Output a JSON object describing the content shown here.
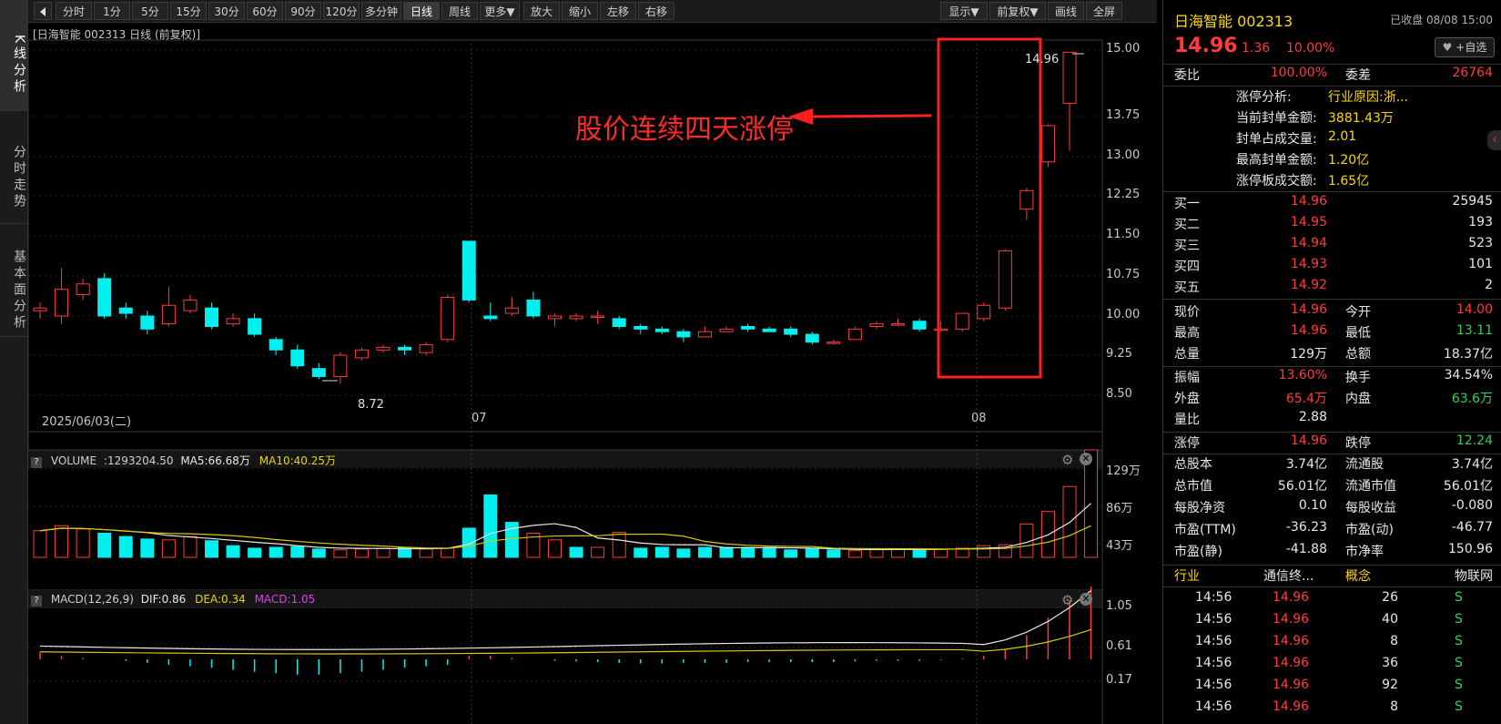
{
  "left_tabs": [
    "K线分析",
    "分时走势",
    "基本面分析"
  ],
  "toolbar": {
    "back_icon": "panel-toggle-icon",
    "periods": [
      "分时",
      "1分",
      "5分",
      "15分",
      "30分",
      "60分",
      "90分",
      "120分",
      "多分钟",
      "日线",
      "周线",
      "更多▼"
    ],
    "active_period": "日线",
    "actions": [
      "放大",
      "缩小",
      "左移",
      "右移"
    ],
    "right_actions": [
      "显示▼",
      "前复权▼",
      "画线",
      "全屏"
    ]
  },
  "chart_title": "日海智能 002313 日线 (前复权)",
  "annotation": "股价连续四天涨停",
  "high_label": "14.96",
  "low_label": "8.72",
  "y_ticks": [
    "15.00",
    "13.75",
    "13.00",
    "12.25",
    "11.50",
    "10.75",
    "10.00",
    "9.25",
    "8.50"
  ],
  "x_dates": [
    "2025/06/03(二)",
    "07",
    "08"
  ],
  "volume_header": {
    "name": "VOLUME",
    "vol": ":1293204.50",
    "ma5": "MA5:66.68万",
    "ma10": "MA10:40.25万"
  },
  "volume_ticks": [
    "129万",
    "86万",
    "43万"
  ],
  "macd_header": {
    "name": "MACD(12,26,9)",
    "dif": "DIF:0.86",
    "dea": "DEA:0.34",
    "macd": "MACD:1.05"
  },
  "macd_ticks": [
    "1.05",
    "0.61",
    "0.17"
  ],
  "chart_data": {
    "type": "candlestick",
    "candles": [
      [
        10.1,
        10.15,
        10.25,
        9.95
      ],
      [
        10.0,
        10.5,
        10.9,
        9.85
      ],
      [
        10.4,
        10.6,
        10.7,
        10.3
      ],
      [
        10.7,
        10.0,
        10.8,
        9.95
      ],
      [
        10.15,
        10.05,
        10.25,
        9.95
      ],
      [
        10.0,
        9.75,
        10.1,
        9.65
      ],
      [
        9.85,
        10.2,
        10.55,
        9.8
      ],
      [
        10.1,
        10.3,
        10.4,
        10.05
      ],
      [
        10.15,
        9.8,
        10.25,
        9.75
      ],
      [
        9.85,
        9.95,
        10.05,
        9.8
      ],
      [
        9.95,
        9.65,
        10.05,
        9.6
      ],
      [
        9.55,
        9.35,
        9.6,
        9.25
      ],
      [
        9.35,
        9.05,
        9.45,
        9.0
      ],
      [
        9.0,
        8.85,
        9.1,
        8.8
      ],
      [
        8.85,
        9.25,
        9.3,
        8.72
      ],
      [
        9.2,
        9.35,
        9.4,
        9.15
      ],
      [
        9.35,
        9.4,
        9.45,
        9.3
      ],
      [
        9.4,
        9.35,
        9.45,
        9.25
      ],
      [
        9.3,
        9.45,
        9.5,
        9.25
      ],
      [
        9.55,
        10.35,
        10.4,
        9.5
      ],
      [
        11.4,
        10.3,
        11.4,
        10.25
      ],
      [
        10.0,
        9.95,
        10.25,
        9.9
      ],
      [
        10.05,
        10.15,
        10.35,
        10.0
      ],
      [
        10.3,
        10.0,
        10.45,
        9.95
      ],
      [
        9.95,
        10.0,
        10.05,
        9.8
      ],
      [
        9.95,
        10.0,
        10.05,
        9.9
      ],
      [
        10.0,
        10.0,
        10.1,
        9.85
      ],
      [
        9.95,
        9.8,
        10.0,
        9.75
      ],
      [
        9.8,
        9.75,
        9.85,
        9.65
      ],
      [
        9.75,
        9.7,
        9.8,
        9.65
      ],
      [
        9.7,
        9.6,
        9.75,
        9.5
      ],
      [
        9.6,
        9.7,
        9.8,
        9.6
      ],
      [
        9.7,
        9.75,
        9.8,
        9.7
      ],
      [
        9.8,
        9.75,
        9.85,
        9.7
      ],
      [
        9.75,
        9.7,
        9.8,
        9.7
      ],
      [
        9.75,
        9.65,
        9.8,
        9.6
      ],
      [
        9.65,
        9.5,
        9.7,
        9.45
      ],
      [
        9.5,
        9.5,
        9.55,
        9.45
      ],
      [
        9.55,
        9.75,
        9.8,
        9.55
      ],
      [
        9.8,
        9.85,
        9.9,
        9.75
      ],
      [
        9.85,
        9.85,
        9.95,
        9.8
      ],
      [
        9.9,
        9.75,
        9.95,
        9.7
      ],
      [
        9.75,
        9.75,
        9.9,
        9.7
      ],
      [
        9.75,
        10.05,
        10.05,
        9.7
      ],
      [
        9.95,
        10.2,
        10.25,
        9.9
      ],
      [
        10.15,
        11.22,
        11.25,
        10.1
      ],
      [
        12.0,
        12.35,
        12.4,
        11.8
      ],
      [
        12.9,
        13.58,
        13.6,
        12.8
      ],
      [
        14.0,
        14.96,
        14.96,
        13.11
      ]
    ],
    "volume_wan": [
      32,
      38,
      34,
      29,
      25,
      22,
      21,
      25,
      20,
      14,
      11,
      12,
      13,
      10,
      9,
      10,
      11,
      12,
      10,
      11,
      35,
      75,
      42,
      29,
      21,
      12,
      12,
      30,
      11,
      12,
      10,
      12,
      12,
      12,
      12,
      9,
      10,
      9,
      8,
      10,
      10,
      10,
      10,
      11,
      14,
      15,
      40,
      55,
      85,
      129
    ],
    "volume_up": [
      true,
      true,
      true,
      false,
      false,
      false,
      true,
      true,
      false,
      false,
      false,
      false,
      false,
      false,
      true,
      true,
      true,
      false,
      true,
      true,
      false,
      false,
      false,
      true,
      true,
      false,
      true,
      true,
      false,
      false,
      false,
      false,
      false,
      false,
      false,
      false,
      false,
      false,
      true,
      true,
      true,
      false,
      true,
      true,
      true,
      true,
      true,
      true,
      true,
      true
    ],
    "macd_hist": [
      0.1,
      0.05,
      0.02,
      0.0,
      -0.02,
      -0.05,
      -0.08,
      -0.1,
      -0.12,
      -0.15,
      -0.18,
      -0.2,
      -0.22,
      -0.22,
      -0.2,
      -0.18,
      -0.15,
      -0.12,
      -0.1,
      -0.08,
      0.05,
      0.05,
      0.02,
      0.0,
      -0.02,
      -0.03,
      -0.04,
      -0.05,
      -0.06,
      -0.06,
      -0.05,
      -0.05,
      -0.05,
      -0.04,
      -0.04,
      -0.04,
      -0.04,
      -0.04,
      -0.03,
      -0.02,
      -0.02,
      -0.02,
      -0.01,
      0.01,
      0.05,
      0.15,
      0.35,
      0.6,
      0.85,
      1.05
    ],
    "y_range": [
      8.5,
      15.0
    ]
  },
  "right_panel": {
    "name": "日海智能 002313",
    "status": "已收盘 08/08 15:00",
    "price": "14.96",
    "change": "1.36",
    "change_pct": "10.00%",
    "watch_btn": "+自选",
    "weibi_label": "委比",
    "weibi": "100.00%",
    "weicha_label": "委差",
    "weicha": "26764",
    "zt_lines": [
      {
        "label": "涨停分析:",
        "value": "行业原因:浙..."
      },
      {
        "label": "当前封单金额:",
        "value": "3881.43万"
      },
      {
        "label": "封单占成交量:",
        "value": "2.01"
      },
      {
        "label": "最高封单金额:",
        "value": "1.20亿"
      },
      {
        "label": "涨停板成交额:",
        "value": "1.65亿"
      }
    ],
    "bids": [
      {
        "label": "买一",
        "price": "14.96",
        "vol": "25945"
      },
      {
        "label": "买二",
        "price": "14.95",
        "vol": "193"
      },
      {
        "label": "买三",
        "price": "14.94",
        "vol": "523"
      },
      {
        "label": "买四",
        "price": "14.93",
        "vol": "101"
      },
      {
        "label": "买五",
        "price": "14.92",
        "vol": "2"
      }
    ],
    "stats": [
      {
        "l1": "现价",
        "v1": "14.96",
        "c1": "red",
        "l2": "今开",
        "v2": "14.00",
        "c2": "red"
      },
      {
        "l1": "最高",
        "v1": "14.96",
        "c1": "red",
        "l2": "最低",
        "v2": "13.11",
        "c2": "green"
      },
      {
        "l1": "总量",
        "v1": "129万",
        "c1": "white",
        "l2": "总额",
        "v2": "18.37亿",
        "c2": "white"
      },
      {
        "l1": "振幅",
        "v1": "13.60%",
        "c1": "red",
        "l2": "换手",
        "v2": "34.54%",
        "c2": "white"
      },
      {
        "l1": "外盘",
        "v1": "65.4万",
        "c1": "red",
        "l2": "内盘",
        "v2": "63.6万",
        "c2": "green"
      },
      {
        "l1": "量比",
        "v1": "2.88",
        "c1": "white",
        "l2": "",
        "v2": "",
        "c2": "white"
      },
      {
        "l1": "涨停",
        "v1": "14.96",
        "c1": "red",
        "l2": "跌停",
        "v2": "12.24",
        "c2": "green"
      },
      {
        "l1": "总股本",
        "v1": "3.74亿",
        "c1": "white",
        "l2": "流通股",
        "v2": "3.74亿",
        "c2": "white"
      },
      {
        "l1": "总市值",
        "v1": "56.01亿",
        "c1": "white",
        "l2": "流通市值",
        "v2": "56.01亿",
        "c2": "white"
      },
      {
        "l1": "每股净资",
        "v1": "0.10",
        "c1": "white",
        "l2": "每股收益",
        "v2": "-0.080",
        "c2": "white"
      },
      {
        "l1": "市盈(TTM)",
        "v1": "-36.23",
        "c1": "white",
        "l2": "市盈(动)",
        "v2": "-46.77",
        "c2": "white"
      },
      {
        "l1": "市盈(静)",
        "v1": "-41.88",
        "c1": "white",
        "l2": "市净率",
        "v2": "150.96",
        "c2": "white"
      }
    ],
    "industry_label": "行业",
    "industry": "通信终...",
    "concept_label": "概念",
    "concept": "物联网",
    "ticks": [
      {
        "time": "14:56",
        "price": "14.96",
        "vol": "26",
        "side": "S"
      },
      {
        "time": "14:56",
        "price": "14.96",
        "vol": "40",
        "side": "S"
      },
      {
        "time": "14:56",
        "price": "14.96",
        "vol": "8",
        "side": "S"
      },
      {
        "time": "14:56",
        "price": "14.96",
        "vol": "36",
        "side": "S"
      },
      {
        "time": "14:56",
        "price": "14.96",
        "vol": "92",
        "side": "S"
      },
      {
        "time": "14:56",
        "price": "14.96",
        "vol": "8",
        "side": "S"
      }
    ]
  }
}
